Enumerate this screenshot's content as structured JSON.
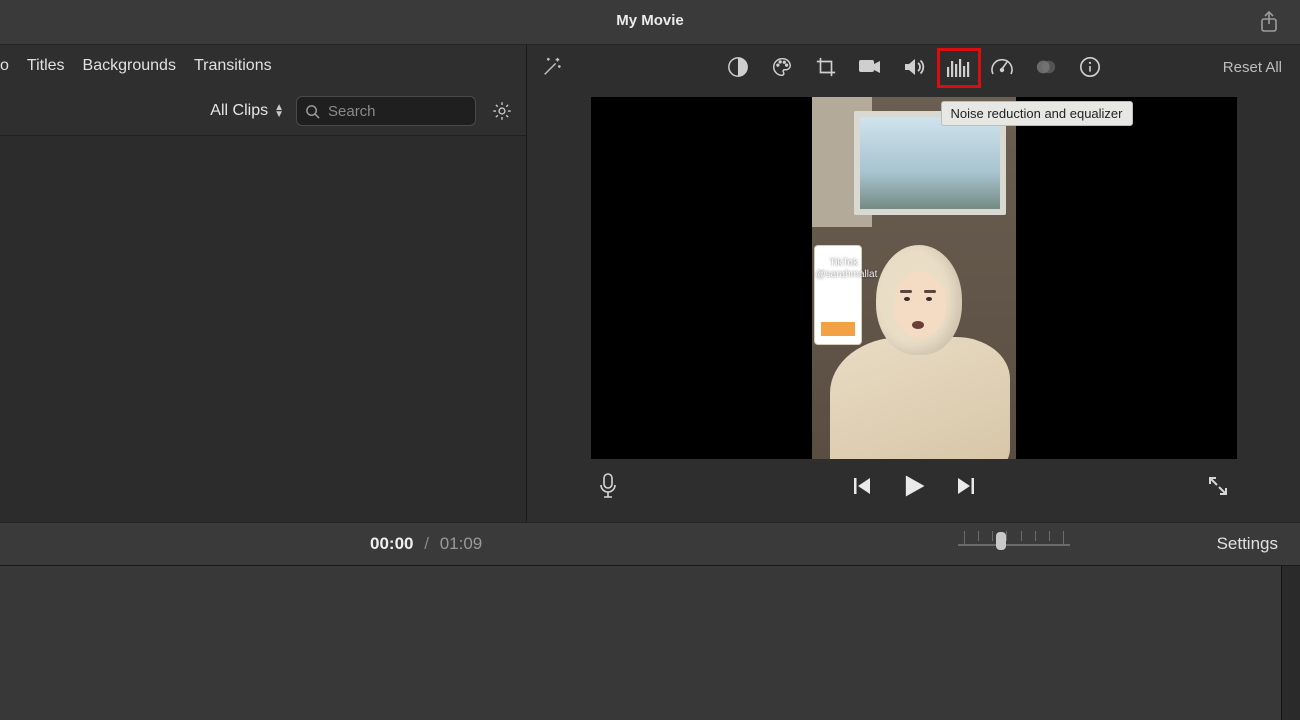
{
  "title": "My Movie",
  "browser_tabs": {
    "partial": "o",
    "items": [
      "Titles",
      "Backgrounds",
      "Transitions"
    ]
  },
  "filter": {
    "label": "All Clips",
    "search_placeholder": "Search"
  },
  "adjust_toolbar": {
    "icons": {
      "color_balance": "color-balance-icon",
      "color_correction": "color-correction-icon",
      "crop": "crop-icon",
      "stabilization": "stabilization-icon",
      "volume": "volume-icon",
      "equalizer": "equalizer-icon",
      "speed": "speed-icon",
      "overlay": "overlay-icon",
      "info": "info-icon"
    },
    "reset_label": "Reset All",
    "tooltip": "Noise reduction and equalizer"
  },
  "watermark": {
    "app": "TikTok",
    "handle": "@sarahmallat"
  },
  "time": {
    "current": "00:00",
    "duration": "01:09",
    "separator": "/"
  },
  "footer": {
    "settings_label": "Settings"
  },
  "colors": {
    "highlight": "#d90e0e"
  }
}
